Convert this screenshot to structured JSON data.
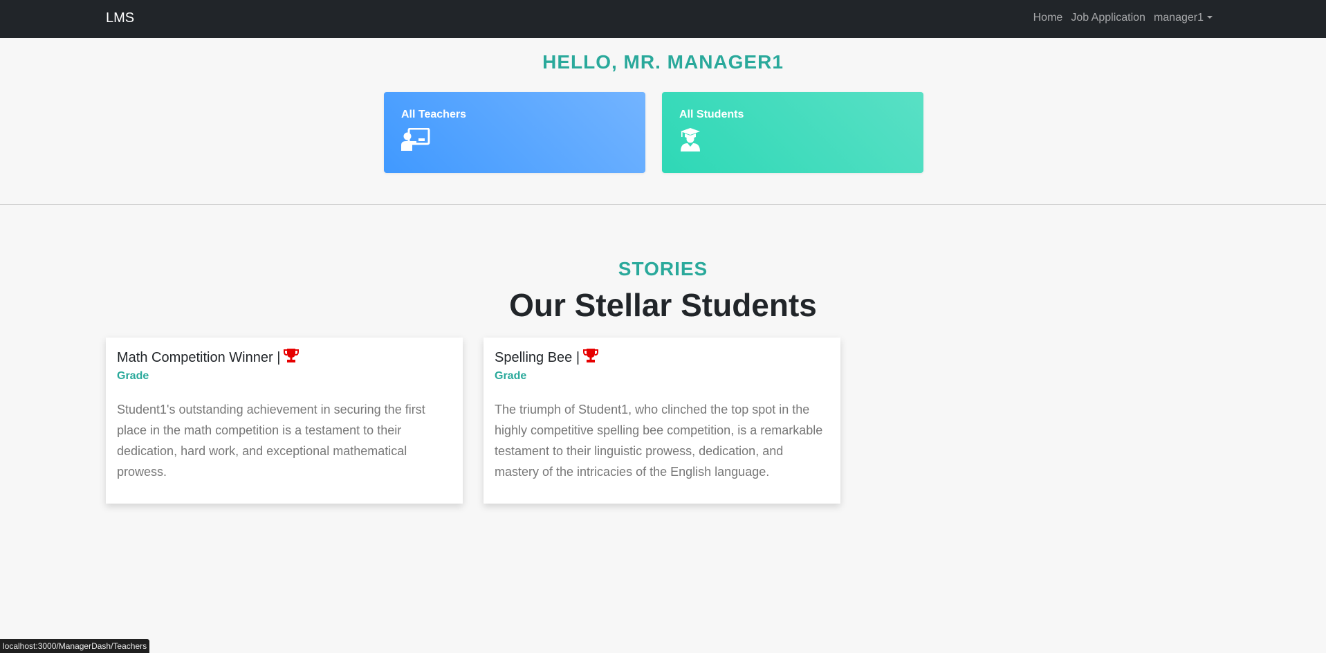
{
  "navbar": {
    "brand": "LMS",
    "links": [
      {
        "label": "Home"
      },
      {
        "label": "Job Application"
      }
    ],
    "user_menu": "manager1"
  },
  "greeting": "HELLO, MR. MANAGER1",
  "dashboard_cards": [
    {
      "title": "All Teachers",
      "icon": "teacher-board-icon",
      "color_from": "#4099ff",
      "color_to": "#73b4ff"
    },
    {
      "title": "All Students",
      "icon": "graduate-icon",
      "color_from": "#2ed8b6",
      "color_to": "#59e0c5"
    }
  ],
  "stories_section": {
    "eyebrow": "STORIES",
    "heading": "Our Stellar Students",
    "cards": [
      {
        "title": "Math Competition Winner |",
        "icon": "trophy-icon",
        "subtitle": "Grade",
        "text": "Student1's outstanding achievement in securing the first place in the math competition is a testament to their dedication, hard work, and exceptional mathematical prowess."
      },
      {
        "title": "Spelling Bee |",
        "icon": "trophy-icon",
        "subtitle": "Grade",
        "text": "The triumph of Student1, who clinched the top spot in the highly competitive spelling bee competition, is a remarkable testament to their linguistic prowess, dedication, and mastery of the intricacies of the English language."
      }
    ]
  },
  "status_bar": "localhost:3000/ManagerDash/Teachers",
  "colors": {
    "accent": "#2aa99b",
    "navbar": "#212529",
    "trophy": "#e60000"
  }
}
